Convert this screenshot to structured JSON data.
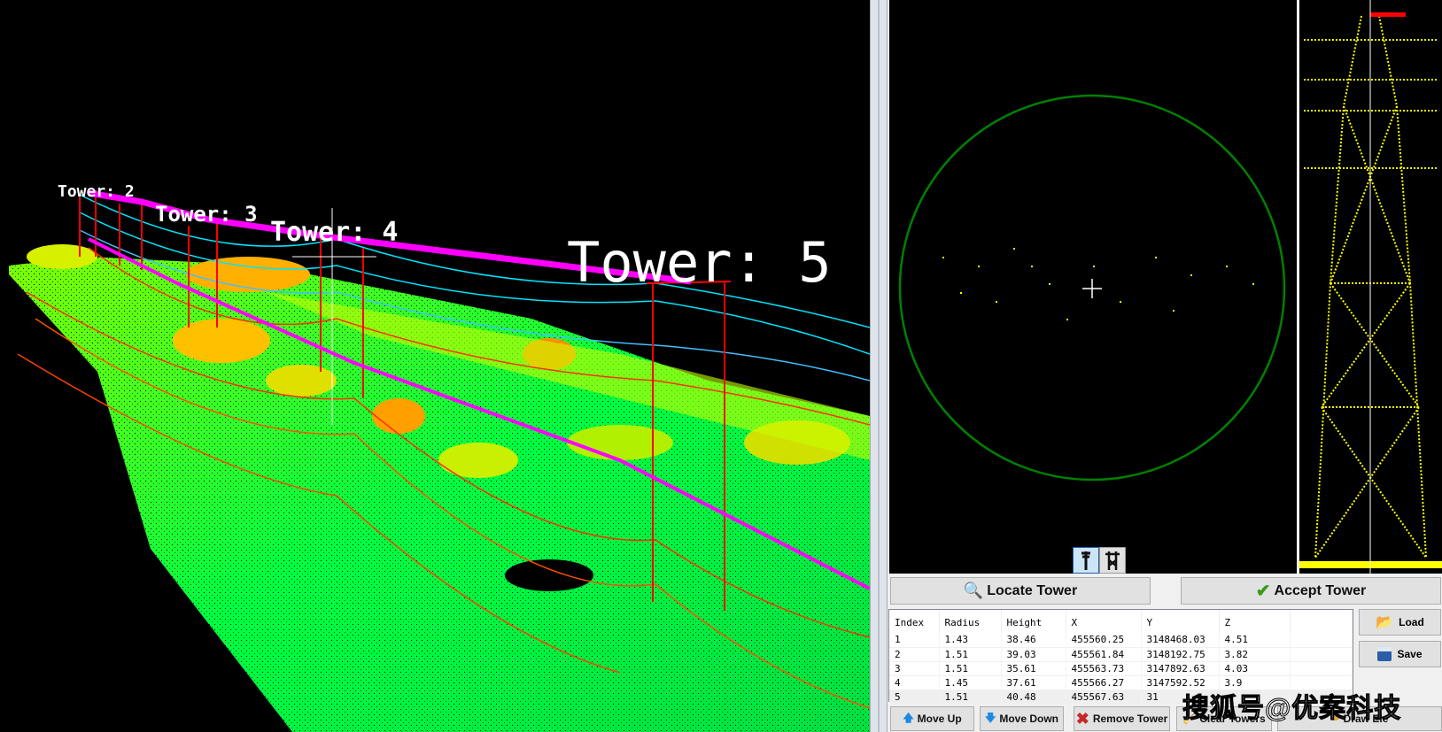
{
  "view3d": {
    "tower_labels": [
      "Tower: 2",
      "Tower: 3",
      "Tower: 4",
      "Tower: 5"
    ],
    "colors": {
      "route_line": "#ff00ff",
      "tower_marker": "#ff0000",
      "wire": "#00e5ff",
      "ground": "#00ff40"
    }
  },
  "top_view": {
    "circle_color": "#008000",
    "crosshair_color": "#ffffff"
  },
  "side_view": {
    "points_color": "#ffff00"
  },
  "view_toggles": [
    {
      "icon": "single-pole-tower-icon",
      "active": true
    },
    {
      "icon": "double-pole-tower-icon",
      "active": false
    }
  ],
  "buttons": {
    "locate_tower": "Locate Tower",
    "accept_tower": "Accept Tower",
    "load": "Load",
    "save": "Save",
    "move_up": "Move Up",
    "move_down": "Move Down",
    "remove_tower": "Remove Tower",
    "clear_towers": "Clear Towers",
    "draw_ele": "Draw Ele"
  },
  "table": {
    "columns": [
      "Index",
      "Radius",
      "Height",
      "X",
      "Y",
      "Z"
    ],
    "rows": [
      [
        "1",
        "1.43",
        "38.46",
        "455560.25",
        "3148468.03",
        "4.51"
      ],
      [
        "2",
        "1.51",
        "39.03",
        "455561.84",
        "3148192.75",
        "3.82"
      ],
      [
        "3",
        "1.51",
        "35.61",
        "455563.73",
        "3147892.63",
        "4.03"
      ],
      [
        "4",
        "1.45",
        "37.61",
        "455566.27",
        "3147592.52",
        "3.9"
      ],
      [
        "5",
        "1.51",
        "40.48",
        "455567.63",
        "31",
        ""
      ]
    ],
    "selected_row": 5
  },
  "watermark": "搜狐号@优案科技"
}
